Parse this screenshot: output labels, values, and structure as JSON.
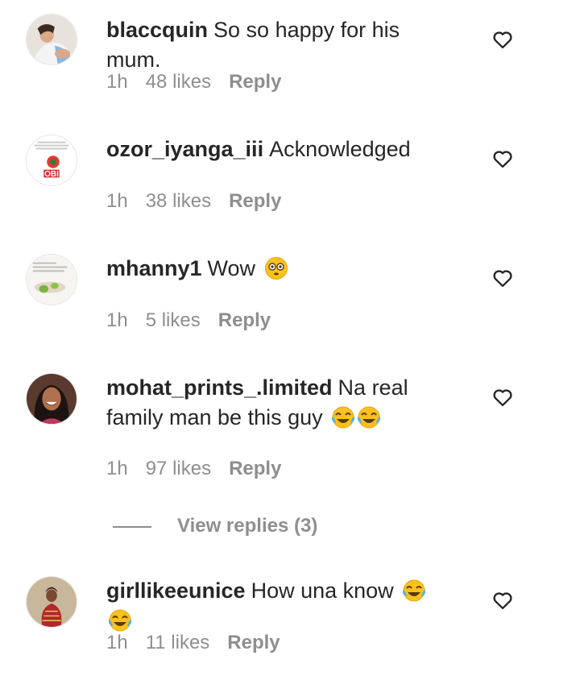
{
  "comments": [
    {
      "username": "blaccquin",
      "text": "So so happy for his mum.",
      "time": "1h",
      "likes": "48 likes",
      "reply_label": "Reply",
      "emoji": ""
    },
    {
      "username": "ozor_iyanga_iii",
      "text": "Acknowledged",
      "time": "1h",
      "likes": "38 likes",
      "reply_label": "Reply",
      "avatar_text": "OBI",
      "emoji": ""
    },
    {
      "username": "mhanny1",
      "text": "Wow",
      "time": "1h",
      "likes": "5 likes",
      "reply_label": "Reply",
      "emoji": "flushed-face"
    },
    {
      "username": "mohat_prints_.limited",
      "text": "Na real family man be this guy",
      "time": "1h",
      "likes": "97 likes",
      "reply_label": "Reply",
      "emoji": "tears-of-joy x2"
    },
    {
      "username": "girllikeeunice",
      "text": "How una know",
      "time": "1h",
      "likes": "11 likes",
      "reply_label": "Reply",
      "emoji": "tears-of-joy x2"
    }
  ],
  "view_replies_label": "View replies (3)",
  "colors": {
    "text": "#262626",
    "secondary": "#8e8e8e",
    "background": "#ffffff",
    "emoji_yellow": "#fcc21b",
    "tear_blue": "#4fb3e8"
  },
  "icons": {
    "like": "heart-outline-icon"
  }
}
